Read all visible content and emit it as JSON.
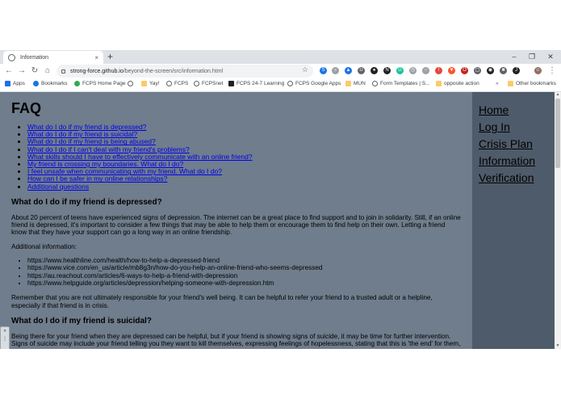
{
  "browser": {
    "tab_title": "Information",
    "tab_close": "×",
    "new_tab": "+",
    "window_controls": [
      "–",
      "❐",
      "✕"
    ],
    "url_host": "strong-force.github.io",
    "url_path": "/beyond-the-screen/src/information.html",
    "bookmarks": [
      {
        "label": "Apps",
        "icon": "apps-icon"
      },
      {
        "label": "Bookmarks",
        "icon": "star-icon"
      },
      {
        "label": "FCPS Home Page",
        "icon": "fcps-icon"
      },
      {
        "label": "",
        "icon": "globe-icon"
      },
      {
        "label": "Yay!",
        "icon": "folder-icon"
      },
      {
        "label": "FCPS",
        "icon": "globe-icon"
      },
      {
        "label": "FCPSnet",
        "icon": "globe-icon"
      },
      {
        "label": "FCPS 24-7 Learning",
        "icon": "bb-icon"
      },
      {
        "label": "FCPS Google Apps",
        "icon": "globe-icon"
      },
      {
        "label": "MUN",
        "icon": "folder-icon"
      },
      {
        "label": "Form Templates | S...",
        "icon": "globe-icon"
      },
      {
        "label": "opposite action",
        "icon": "folder-icon"
      },
      {
        "label": "Other bookmarks",
        "icon": "folder-icon"
      }
    ]
  },
  "page": {
    "heading": "FAQ",
    "toc": [
      "What do I do if my friend is depressed?",
      "What do I do if my friend is suicidal?",
      "What do I do if my friend is being abused?",
      "What do I do if I can't deal with my friend's problems?",
      "What skills should I have to effectively communicate with an online friend?",
      "My friend is crossing my boundaries. What do I do?",
      "I feel unsafe when communicating with my friend. What do I do?",
      "How can I be safer in my online relationships?",
      "Additional questions"
    ],
    "sections": [
      {
        "question": "What do I do if my friend is depressed?",
        "paragraph": "About 20 percent of teens have experienced signs of depression. The internet can be a great place to find support and to join in solidarity. Still, if an online friend is depressed, it's important to consider a few things that may be able to help them or encourage them to find help on their own. Letting a friend know that they have your support can go a long way in an online friendship.",
        "additional_label": "Additional information:",
        "links": [
          "https://www.healthline.com/health/how-to-help-a-depressed-friend",
          "https://www.vice.com/en_us/article/mb8g3n/how-do-you-help-an-online-friend-who-seems-depressed",
          "https://au.reachout.com/articles/6-ways-to-help-a-friend-with-depression",
          "https://www.helpguide.org/articles/depression/helping-someone-with-depression.htm"
        ],
        "closing": "Remember that you are not ultimately responsible for your friend's well being. It can be helpful to refer your friend to a trusted adult or a helpline, especially if that friend is in crisis."
      },
      {
        "question": "What do I do if my friend is suicidal?",
        "paragraph": "Being there for your friend when they are depressed can be helpful, but if your friend is showing signs of suicide, it may be time for further intervention. Signs of suicide may include your friend telling you they want to kill themselves, expressing feelings of hopelessness, stating that this is 'the end' for them, or"
      }
    ],
    "nav": [
      "Home",
      "Log In",
      "Crisis Plan",
      "Information",
      "Verification"
    ]
  }
}
